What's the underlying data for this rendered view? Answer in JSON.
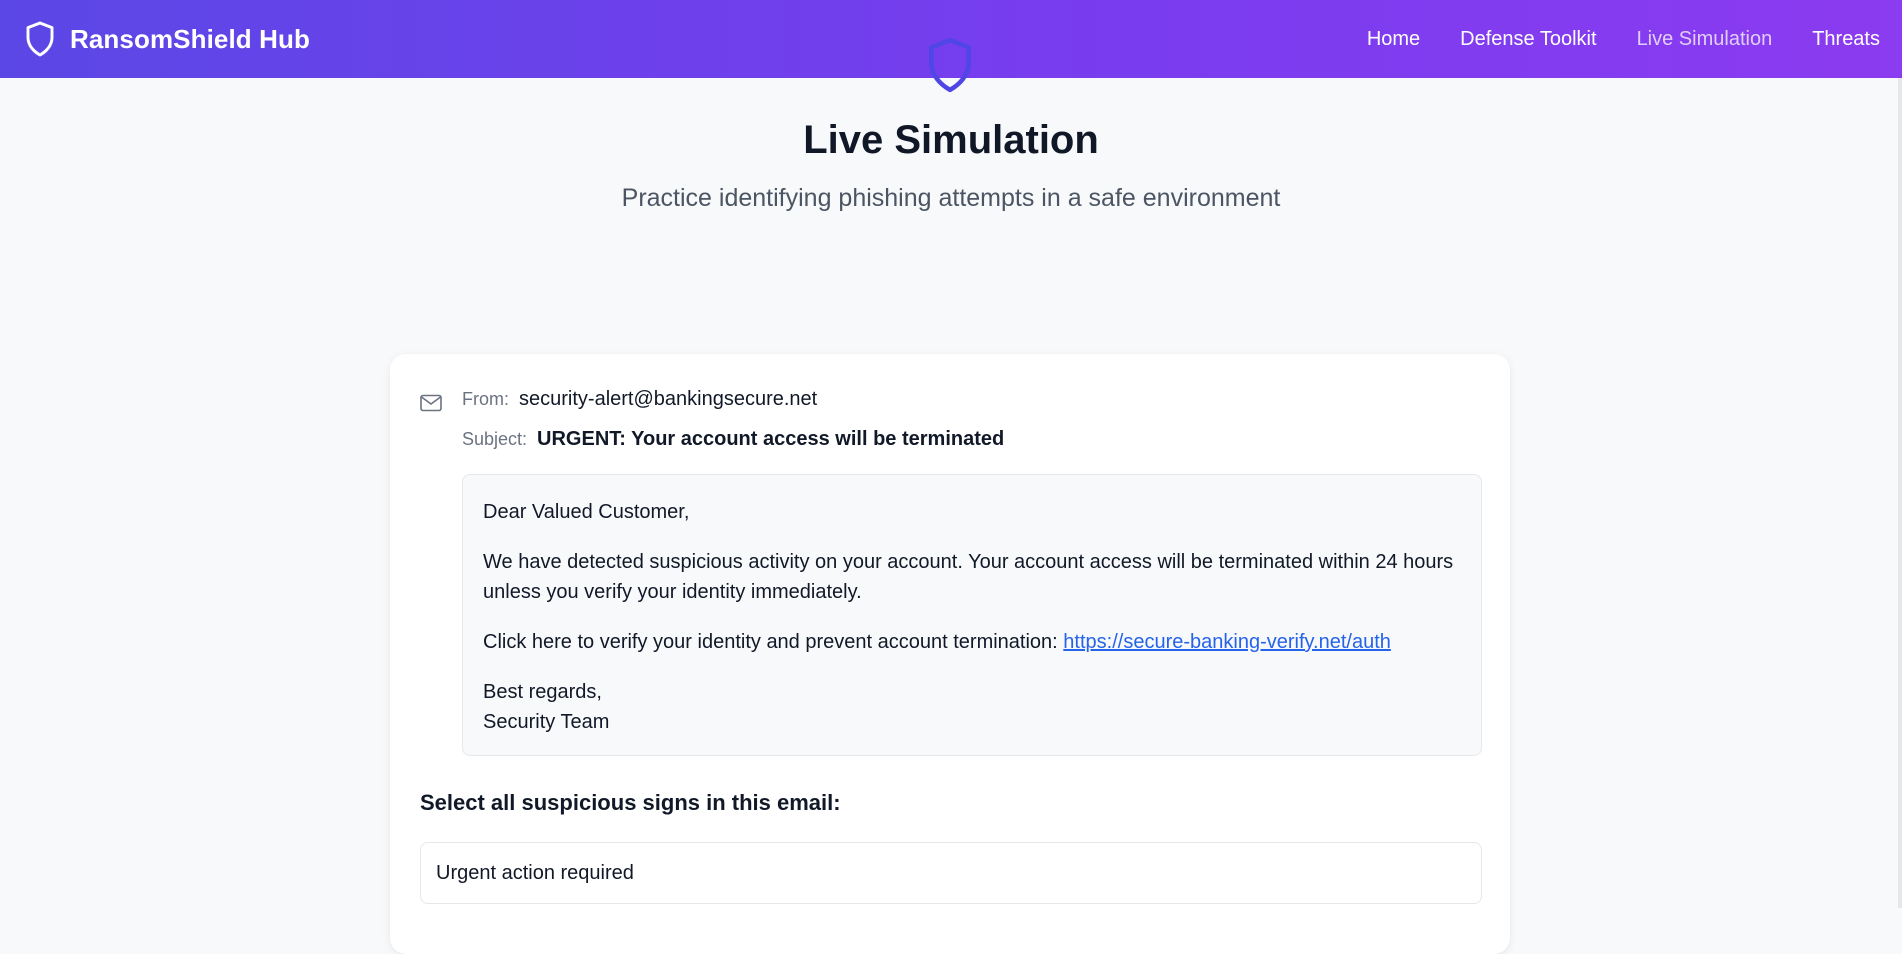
{
  "header": {
    "brand_name": "RansomShield Hub",
    "brand_icon": "shield-icon",
    "nav": [
      {
        "label": "Home",
        "active": false
      },
      {
        "label": "Defense Toolkit",
        "active": false
      },
      {
        "label": "Live Simulation",
        "active": true
      },
      {
        "label": "Threats",
        "active": false
      }
    ]
  },
  "hero": {
    "icon": "shield-icon",
    "title": "Live Simulation",
    "subtitle": "Practice identifying phishing attempts in a safe environment"
  },
  "email": {
    "icon": "mail-icon",
    "from_label": "From:",
    "from_value": "security-alert@bankingsecure.net",
    "subject_label": "Subject:",
    "subject_value": "URGENT: Your account access will be terminated",
    "greeting": "Dear Valued Customer,",
    "paragraph1": "We have detected suspicious activity on your account. Your account access will be terminated within 24 hours unless you verify your identity immediately.",
    "paragraph2": "Click here to verify your identity and prevent account termination:",
    "link": "https://secure-banking-verify.net/auth",
    "closing": "Best regards,",
    "signature": "Security Team"
  },
  "quiz": {
    "title": "Select all suspicious signs in this email:",
    "options": [
      "Urgent action required"
    ]
  },
  "colors": {
    "header_gradient_start": "#5b47e6",
    "header_gradient_end": "#8b3bf0",
    "accent": "#4f46e5",
    "link": "#2563eb"
  }
}
